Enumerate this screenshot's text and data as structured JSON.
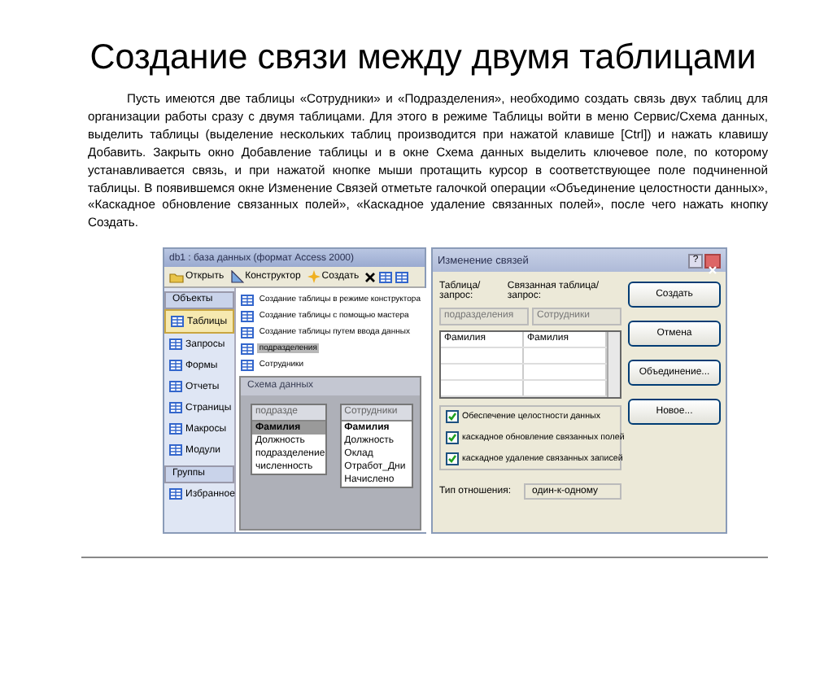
{
  "title": "Создание связи между двумя таблицами",
  "paragraph": "Пусть имеются две таблицы «Сотрудники» и «Подразделения», необходимо создать связь двух таблиц для организации работы сразу с двумя таблицами. Для этого в режиме Таблицы войти в меню Сервис/Схема данных, выделить таблицы (выделение нескольких таблиц производится при нажатой клавише [Ctrl]) и нажать клавишу Добавить. Закрыть окно Добавление таблицы и в окне Схема данных выделить ключевое поле, по которому устанавливается связь, и при нажатой кнопке мыши протащить курсор в соответствующее поле подчиненной таблицы. В появившемся окне Изменение Связей отметьте галочкой операции «Объединение целостности данных», «Каскадное обновление связанных полей», «Каскадное удаление связанных полей», после чего нажать кнопку Создать.",
  "db_window": {
    "title": "db1 : база данных (формат Access 2000)",
    "toolbar": [
      {
        "kind": "open",
        "label": "Открыть"
      },
      {
        "kind": "design",
        "label": "Конструктор"
      },
      {
        "kind": "create",
        "label": "Создать"
      }
    ],
    "objects_header": "Объекты",
    "objects": [
      {
        "label": "Таблицы",
        "selected": true
      },
      {
        "label": "Запросы",
        "selected": false
      },
      {
        "label": "Формы",
        "selected": false
      },
      {
        "label": "Отчеты",
        "selected": false
      },
      {
        "label": "Страницы",
        "selected": false
      },
      {
        "label": "Макросы",
        "selected": false
      },
      {
        "label": "Модули",
        "selected": false
      }
    ],
    "groups_header": "Группы",
    "groups": [
      {
        "label": "Избранное",
        "selected": false
      }
    ],
    "items": [
      {
        "label": "Создание таблицы в режиме конструктора",
        "selected": false
      },
      {
        "label": "Создание таблицы с помощью мастера",
        "selected": false
      },
      {
        "label": "Создание таблицы путем ввода данных",
        "selected": false
      },
      {
        "label": "подразделения",
        "selected": true
      },
      {
        "label": "Сотрудники",
        "selected": false
      }
    ],
    "schema_window": {
      "title": "Схема данных",
      "tables": [
        {
          "name": "подразде",
          "fields": [
            {
              "label": "Фамилия",
              "selected": true
            },
            {
              "label": "Должность",
              "selected": false
            },
            {
              "label": "подразделение",
              "selected": false
            },
            {
              "label": "численность",
              "selected": false
            }
          ]
        },
        {
          "name": "Сотрудники",
          "fields": [
            {
              "label": "Фамилия",
              "selected": false
            },
            {
              "label": "Должность",
              "selected": false
            },
            {
              "label": "Оклад",
              "selected": false
            },
            {
              "label": "Отработ_Дни",
              "selected": false
            },
            {
              "label": "Начислено",
              "selected": false
            }
          ]
        }
      ]
    }
  },
  "relations_dialog": {
    "title": "Изменение связей",
    "help": "?",
    "table_label": "Таблица/запрос:",
    "related_label": "Связанная таблица/запрос:",
    "table_value": "подразделения",
    "related_value": "Сотрудники",
    "combos_disabled": true,
    "fields": [
      {
        "table_field": "Фамилия",
        "related_field": "Фамилия"
      }
    ],
    "options": [
      {
        "label": "Обеспечение целостности данных",
        "checked": true
      },
      {
        "label": "каскадное обновление связанных полей",
        "checked": true
      },
      {
        "label": "каскадное удаление связанных записей",
        "checked": true
      }
    ],
    "relation_type_label": "Тип отношения:",
    "relation_type": "один-к-одному",
    "buttons": [
      {
        "label": "Создать"
      },
      {
        "label": "Отмена"
      },
      {
        "label": "Объединение..."
      },
      {
        "label": "Новое..."
      }
    ]
  }
}
